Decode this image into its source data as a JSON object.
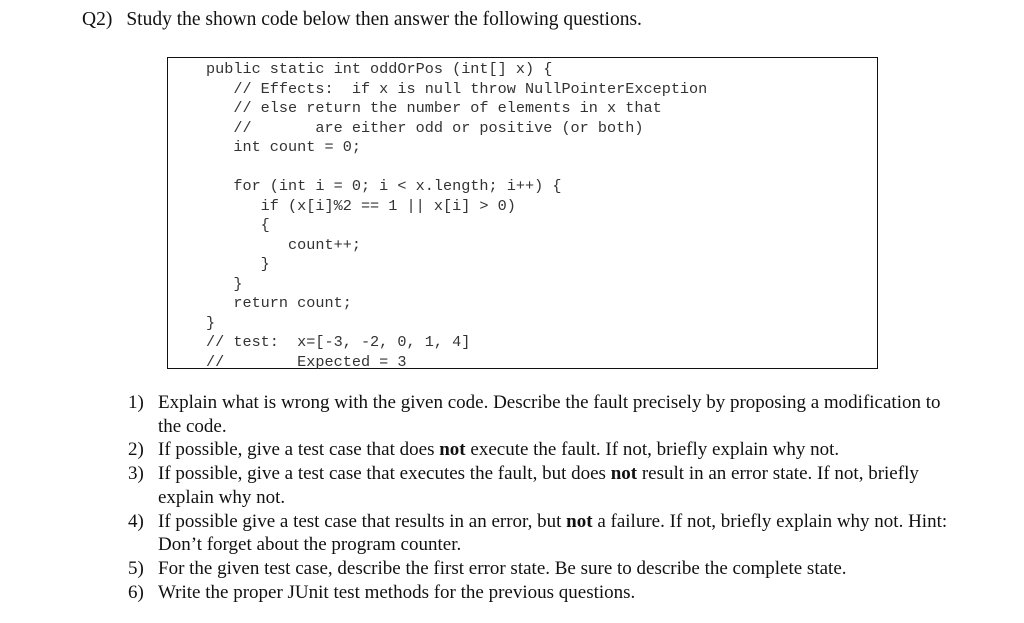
{
  "title": {
    "number": "Q2)",
    "text": "Study the shown code below then answer the following questions."
  },
  "code": {
    "lines": [
      "public static int oddOrPos (int[] x) {",
      "   // Effects:  if x is null throw NullPointerException",
      "   // else return the number of elements in x that",
      "   //       are either odd or positive (or both)",
      "   int count = 0;",
      "",
      "   for (int i = 0; i < x.length; i++) {",
      "      if (x[i]%2 == 1 || x[i] > 0)",
      "      {",
      "         count++;",
      "      }",
      "   }",
      "   return count;",
      "}",
      "// test:  x=[-3, -2, 0, 1, 4]",
      "//        Expected = 3"
    ]
  },
  "questions": [
    {
      "number": "1)",
      "before": "Explain what is wrong with the given code. Describe the fault precisely by proposing a modification to the code.",
      "bold": "",
      "after": ""
    },
    {
      "number": "2)",
      "before": "If possible, give a test case that does ",
      "bold": "not",
      "after": " execute the fault. If not, briefly explain why not."
    },
    {
      "number": "3)",
      "before": "If possible, give a test case that executes the fault, but does ",
      "bold": "not",
      "after": " result in an error state. If not, briefly explain why not."
    },
    {
      "number": "4)",
      "before": "If possible give a test case that results in an error, but ",
      "bold": "not",
      "after": " a failure. If not, briefly explain why not. Hint: Don’t forget about the program counter."
    },
    {
      "number": "5)",
      "before": "For the given test case, describe the first error state. Be sure to describe the complete state.",
      "bold": "",
      "after": ""
    },
    {
      "number": "6)",
      "before": "Write the proper JUnit test methods for the previous questions.",
      "bold": "",
      "after": ""
    }
  ]
}
